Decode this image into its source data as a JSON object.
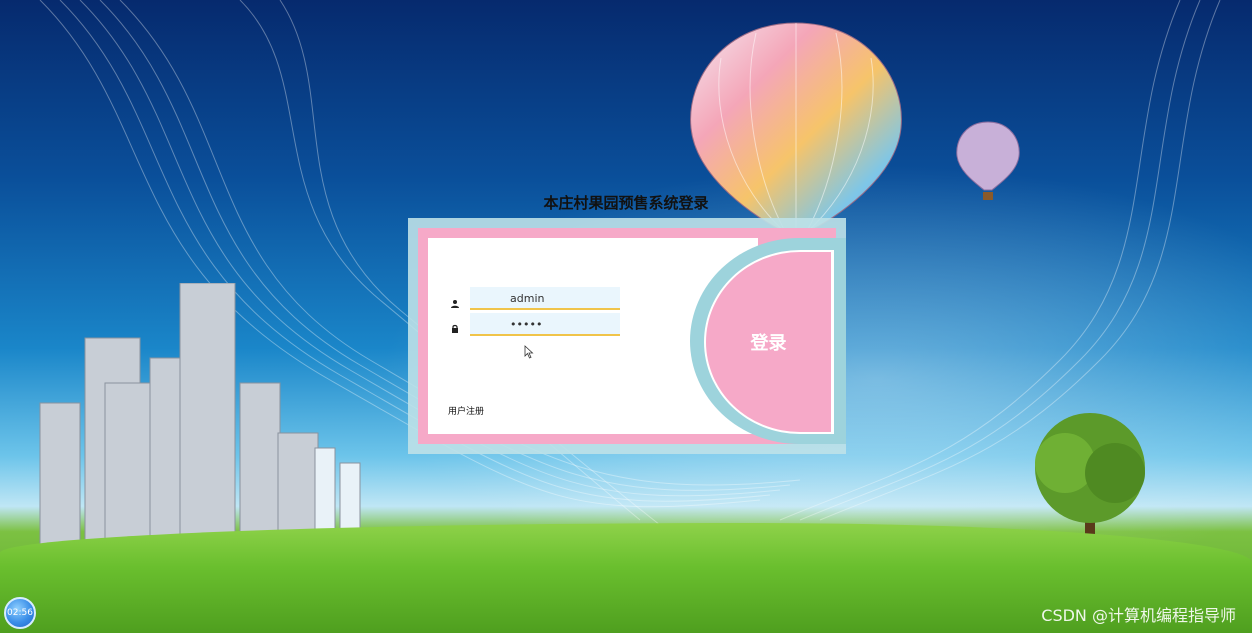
{
  "page": {
    "title": "本庄村果园预售系统登录"
  },
  "login_form": {
    "username_value": "admin",
    "password_value": "•••••",
    "login_button_label": "登录",
    "register_link_label": "用户注册"
  },
  "overlay": {
    "clock_text": "02:56",
    "watermark_text": "CSDN @计算机编程指导师"
  },
  "colors": {
    "panel_pink": "#f6a9c8",
    "panel_teal": "#9dd3dc",
    "field_underline": "#f0c44a"
  }
}
